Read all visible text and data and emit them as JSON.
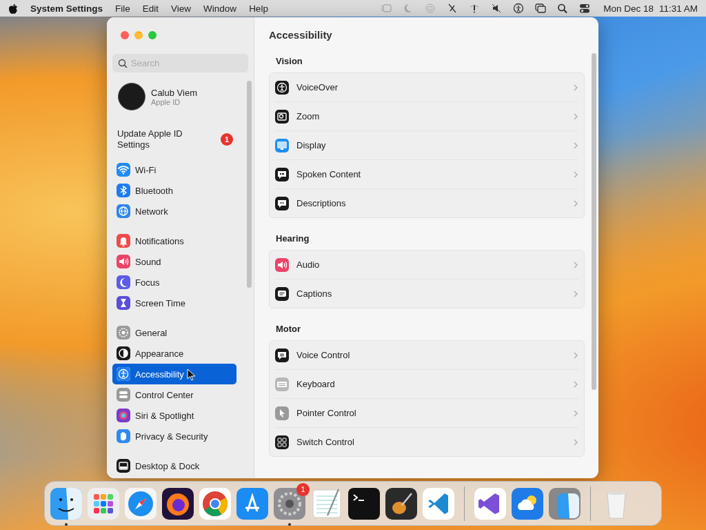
{
  "menu_bar": {
    "app_name": "System Settings",
    "menus": [
      "File",
      "Edit",
      "View",
      "Window",
      "Help"
    ],
    "date": "Mon Dec 18",
    "time": "11:31 AM"
  },
  "sidebar": {
    "search": {
      "placeholder": "Search"
    },
    "account": {
      "name": "Calub Viem",
      "subtitle": "Apple ID"
    },
    "notice": {
      "text": "Update Apple ID Settings",
      "badge": "1"
    },
    "groups": [
      [
        {
          "label": "Wi-Fi",
          "color": "#1f8cf0",
          "selected": false
        },
        {
          "label": "Bluetooth",
          "color": "#1f7cf0",
          "selected": false
        },
        {
          "label": "Network",
          "color": "#2e86e8",
          "selected": false
        }
      ],
      [
        {
          "label": "Notifications",
          "color": "#ef4b4b",
          "selected": false
        },
        {
          "label": "Sound",
          "color": "#ec4468",
          "selected": false
        },
        {
          "label": "Focus",
          "color": "#5d5ce6",
          "selected": false
        },
        {
          "label": "Screen Time",
          "color": "#5b4fd6",
          "selected": false
        }
      ],
      [
        {
          "label": "General",
          "color": "#9a9a9a",
          "selected": false
        },
        {
          "label": "Appearance",
          "color": "#1a1a1a",
          "selected": false
        },
        {
          "label": "Accessibility",
          "color": "#1f7ef0",
          "selected": true
        },
        {
          "label": "Control Center",
          "color": "#9a9a9a",
          "selected": false
        },
        {
          "label": "Siri & Spotlight",
          "color": "#7a3cc9",
          "selected": false
        },
        {
          "label": "Privacy & Security",
          "color": "#2f8af0",
          "selected": false
        }
      ],
      [
        {
          "label": "Desktop & Dock",
          "color": "#1a1a1a",
          "selected": false
        }
      ]
    ]
  },
  "content": {
    "title": "Accessibility",
    "sections": [
      {
        "heading": "Vision",
        "rows": [
          {
            "label": "VoiceOver",
            "color": "#1a1a1a"
          },
          {
            "label": "Zoom",
            "color": "#1a1a1a"
          },
          {
            "label": "Display",
            "color": "#1e8ff2"
          },
          {
            "label": "Spoken Content",
            "color": "#1a1a1a"
          },
          {
            "label": "Descriptions",
            "color": "#1a1a1a"
          }
        ]
      },
      {
        "heading": "Hearing",
        "rows": [
          {
            "label": "Audio",
            "color": "#ec4468"
          },
          {
            "label": "Captions",
            "color": "#1a1a1a"
          }
        ]
      },
      {
        "heading": "Motor",
        "rows": [
          {
            "label": "Voice Control",
            "color": "#1a1a1a"
          },
          {
            "label": "Keyboard",
            "color": "#b8b8b8"
          },
          {
            "label": "Pointer Control",
            "color": "#9a9a9a"
          },
          {
            "label": "Switch Control",
            "color": "#1a1a1a"
          }
        ]
      }
    ]
  },
  "dock": {
    "items": [
      {
        "running": true
      },
      {
        "running": false
      },
      {
        "running": false
      },
      {
        "running": false
      },
      {
        "running": false
      },
      {
        "running": false
      },
      {
        "running": true,
        "badge": "1"
      },
      {
        "running": false
      },
      {
        "running": false
      },
      {
        "running": false
      },
      {
        "running": false
      },
      {
        "running": false
      },
      {
        "running": false
      },
      {
        "running": false
      },
      {
        "running": false
      }
    ]
  }
}
